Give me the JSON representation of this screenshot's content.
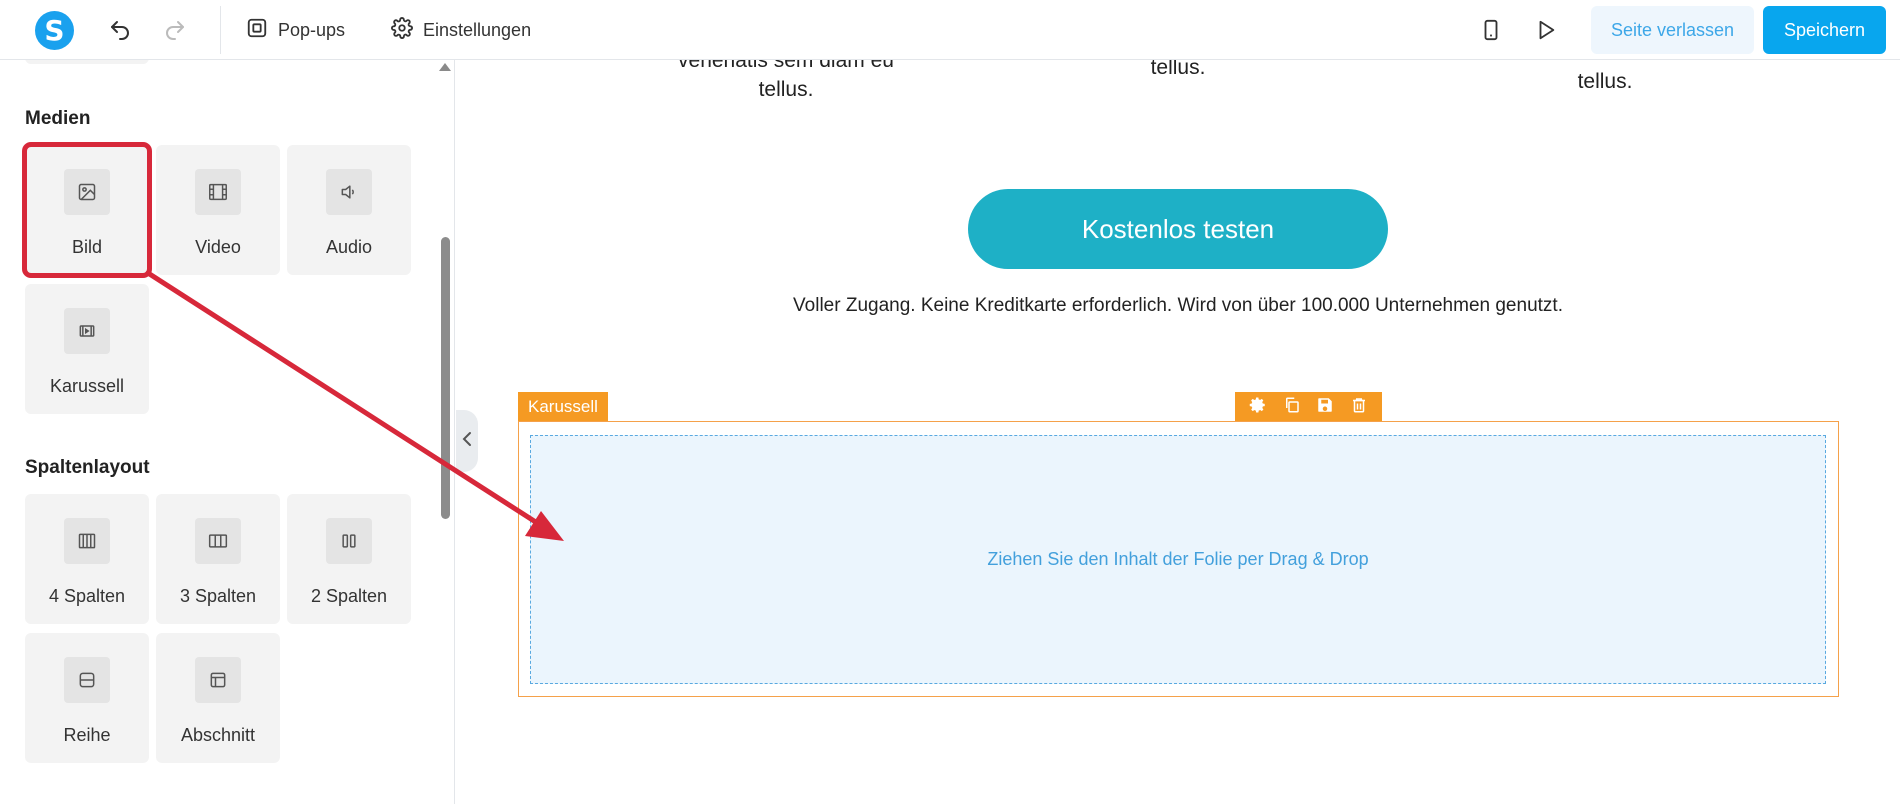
{
  "topbar": {
    "logo_letter": "S",
    "nav": {
      "popups_label": "Pop-ups",
      "settings_label": "Einstellungen"
    },
    "leave_label": "Seite verlassen",
    "save_label": "Speichern"
  },
  "sidebar": {
    "media": {
      "title": "Medien",
      "items": [
        {
          "label": "Bild",
          "icon": "image-icon"
        },
        {
          "label": "Video",
          "icon": "film-icon"
        },
        {
          "label": "Audio",
          "icon": "speaker-icon"
        },
        {
          "label": "Karussell",
          "icon": "carousel-icon"
        }
      ]
    },
    "columns": {
      "title": "Spaltenlayout",
      "items": [
        {
          "label": "4 Spalten",
          "icon": "four-columns-icon"
        },
        {
          "label": "3 Spalten",
          "icon": "three-columns-icon"
        },
        {
          "label": "2 Spalten",
          "icon": "two-columns-icon"
        },
        {
          "label": "Reihe",
          "icon": "row-icon"
        },
        {
          "label": "Abschnitt",
          "icon": "section-icon"
        }
      ]
    }
  },
  "canvas": {
    "teaser_1_top": "venenatis sem diam eu",
    "teaser_1_bottom": "tellus.",
    "teaser_2": "tellus.",
    "teaser_3": "tellus.",
    "cta_label": "Kostenlos testen",
    "cta_sub": "Voller Zugang. Keine Kreditkarte erforderlich. Wird von über 100.000 Unternehmen genutzt.",
    "carousel": {
      "tag": "Karussell",
      "placeholder": "Ziehen Sie den Inhalt der Folie per Drag & Drop"
    }
  },
  "colors": {
    "brand": "#1aa1ee",
    "save": "#08a6ee",
    "cta": "#1eb0c6",
    "carousel_accent": "#f59a23",
    "highlight": "#d7283a"
  }
}
